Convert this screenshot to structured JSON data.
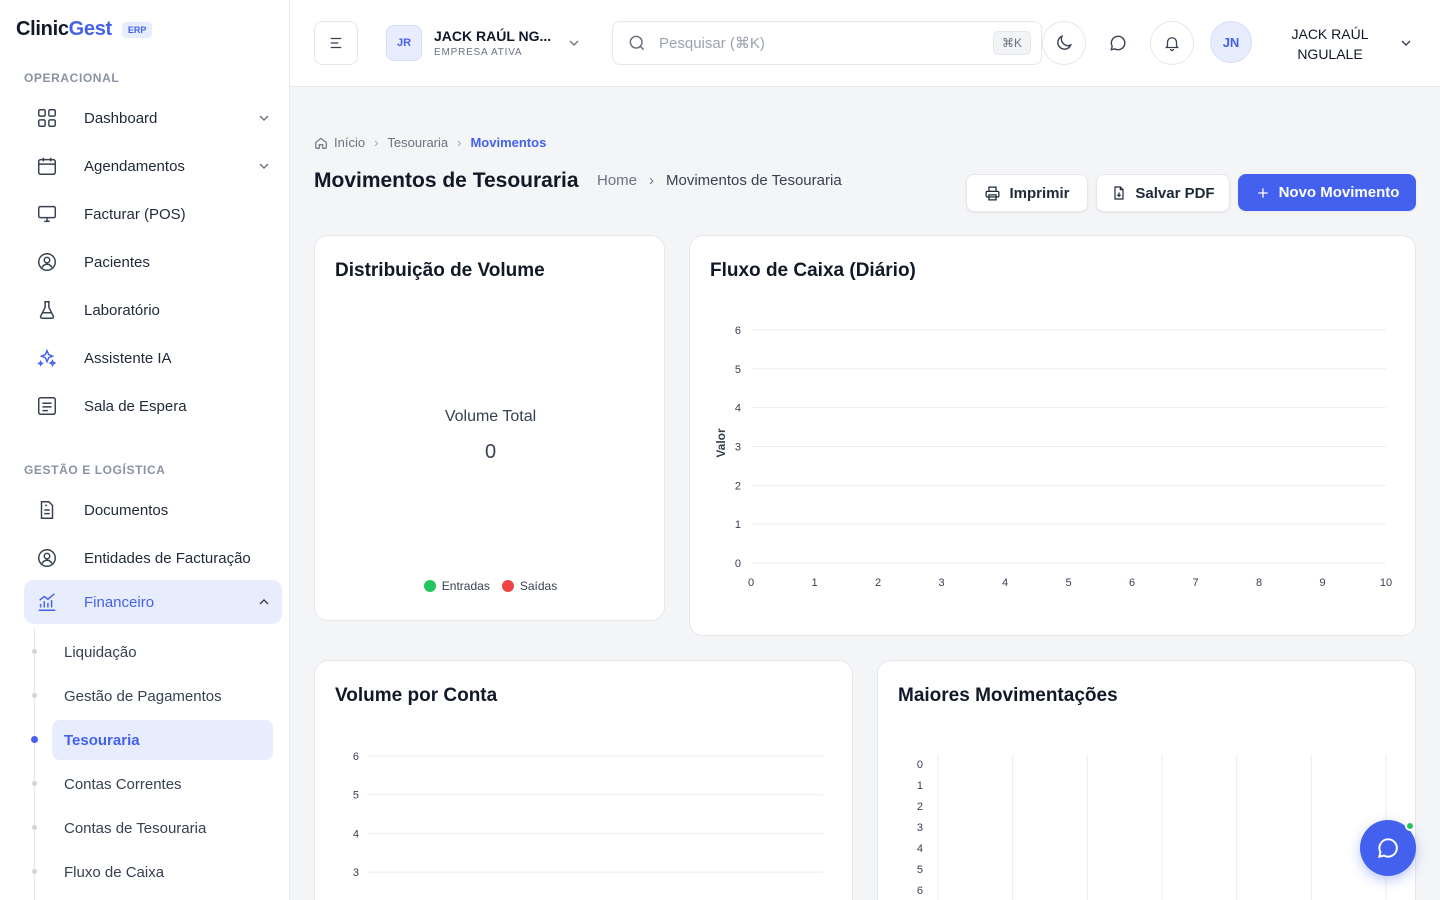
{
  "brand": {
    "name_part1": "Clinic",
    "name_part2": "Gest",
    "tag": "ERP"
  },
  "sidebar": {
    "section1": "OPERACIONAL",
    "section2": "GESTÃO E LOGÍSTICA",
    "items1": [
      {
        "label": "Dashboard",
        "icon": "grid-icon"
      },
      {
        "label": "Agendamentos",
        "icon": "calendar-icon"
      },
      {
        "label": "Facturar (POS)",
        "icon": "monitor-icon"
      },
      {
        "label": "Pacientes",
        "icon": "user-circle-icon"
      },
      {
        "label": "Laboratório",
        "icon": "flask-icon"
      },
      {
        "label": "Assistente IA",
        "icon": "sparkles-icon"
      },
      {
        "label": "Sala de Espera",
        "icon": "list-icon"
      }
    ],
    "items2": [
      {
        "label": "Documentos",
        "icon": "document-icon"
      },
      {
        "label": "Entidades de Facturação",
        "icon": "user-circle-icon"
      },
      {
        "label": "Financeiro",
        "icon": "chart-icon"
      }
    ],
    "subitems": [
      {
        "label": "Liquidação"
      },
      {
        "label": "Gestão de Pagamentos"
      },
      {
        "label": "Tesouraria"
      },
      {
        "label": "Contas Correntes"
      },
      {
        "label": "Contas de Tesouraria"
      },
      {
        "label": "Fluxo de Caixa"
      }
    ]
  },
  "header": {
    "company_initials": "JR",
    "company_name": "JACK RAÚL NG...",
    "company_sub": "EMPRESA ATIVA",
    "search_placeholder": "Pesquisar (⌘K)",
    "search_kbd": "⌘K",
    "user_initials": "JN",
    "user_name": "JACK RAÚL NGULALE"
  },
  "breadcrumb": {
    "home": "Início",
    "level1": "Tesouraria",
    "current": "Movimentos"
  },
  "page": {
    "title": "Movimentos de Tesouraria",
    "crumb_home": "Home",
    "crumb_current": "Movimentos de Tesouraria",
    "btn_print": "Imprimir",
    "btn_pdf": "Salvar PDF",
    "btn_new": "Novo Movimento"
  },
  "cards": {
    "volume_dist": {
      "title": "Distribuição de Volume",
      "center_label": "Volume Total",
      "center_value": "0",
      "legend_in": "Entradas",
      "legend_out": "Saídas",
      "color_in": "#22c55e",
      "color_out": "#ef4444"
    },
    "cash_flow": {
      "title": "Fluxo de Caixa (Diário)"
    },
    "by_account": {
      "title": "Volume por Conta"
    },
    "top_moves": {
      "title": "Maiores Movimentações"
    }
  },
  "chart_data": [
    {
      "type": "pie",
      "title": "Distribuição de Volume",
      "labels": [
        "Entradas",
        "Saídas"
      ],
      "values": [
        0,
        0
      ],
      "center_label": "Volume Total",
      "center_value": "0"
    },
    {
      "type": "line",
      "title": "Fluxo de Caixa (Diário)",
      "ylabel": "Valor",
      "x_ticks": [
        "0",
        "1",
        "2",
        "3",
        "4",
        "5",
        "6",
        "7",
        "8",
        "9",
        "10"
      ],
      "y_ticks": [
        "0",
        "1",
        "2",
        "3",
        "4",
        "5",
        "6"
      ],
      "xlim": [
        0,
        10
      ],
      "ylim": [
        0,
        6
      ],
      "series": [],
      "grid": true
    },
    {
      "type": "bar",
      "title": "Volume por Conta",
      "y_ticks": [
        "3",
        "4",
        "5",
        "6"
      ],
      "ylim": [
        0,
        6
      ],
      "series": [],
      "grid": true
    },
    {
      "type": "bar",
      "title": "Maiores Movimentações",
      "y_ticks": [
        "0",
        "1",
        "2",
        "3",
        "4",
        "5",
        "6"
      ],
      "series": [],
      "grid": true
    }
  ]
}
